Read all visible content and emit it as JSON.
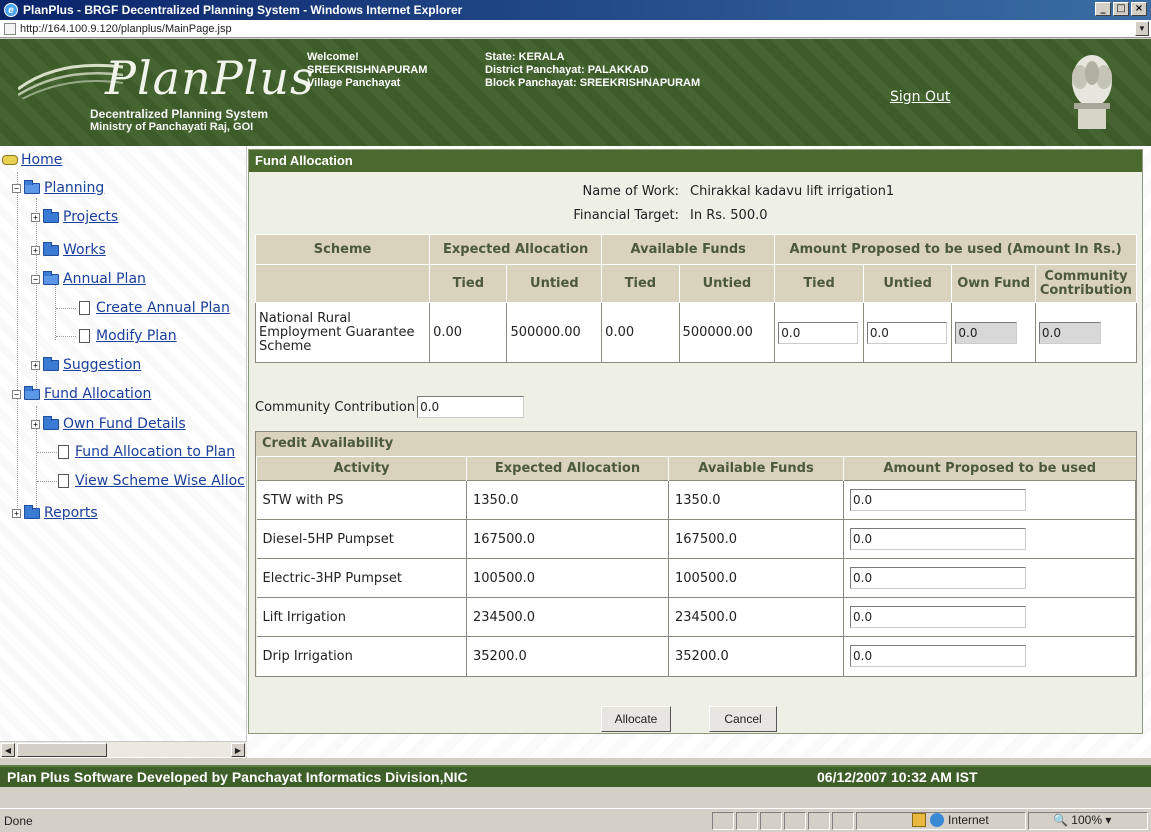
{
  "window": {
    "title": "PlanPlus - BRGF Decentralized Planning System - Windows Internet Explorer",
    "url": "http://164.100.9.120/planplus/MainPage.jsp",
    "min": "_",
    "max": "□",
    "close": "×"
  },
  "header": {
    "logo": "PlanPlus",
    "logo_sub1": "Decentralized Planning System",
    "logo_sub2": "Ministry of Panchayati Raj, GOI",
    "welcome": [
      "Welcome!",
      "SREEKRISHNAPURAM",
      "Village Panchayat"
    ],
    "state": [
      "State: KERALA",
      "District Panchayat: PALAKKAD",
      "Block Panchayat: SREEKRISHNAPURAM"
    ],
    "signout": "Sign Out"
  },
  "sidebar": {
    "home": "Home",
    "planning": "Planning",
    "projects": "Projects",
    "works": "Works",
    "annual_plan": "Annual Plan",
    "create_annual_plan": "Create Annual Plan",
    "modify_plan": "Modify Plan",
    "suggestion": "Suggestion",
    "fund_allocation": "Fund Allocation",
    "own_fund_details": "Own Fund Details",
    "fund_allocation_to_plan": "Fund Allocation to Plan",
    "view_scheme_wise": "View Scheme Wise Alloc",
    "reports": "Reports"
  },
  "main": {
    "title": "Fund Allocation",
    "name_of_work_label": "Name of Work:",
    "name_of_work": "Chirakkal kadavu lift irrigation1",
    "financial_target_label": "Financial Target:",
    "financial_target": "In Rs. 500.0",
    "fund_table": {
      "headers": {
        "scheme": "Scheme",
        "expected": "Expected Allocation",
        "available": "Available Funds",
        "proposed": "Amount Proposed to be used (Amount In Rs.)",
        "tied": "Tied",
        "untied": "Untied",
        "own_fund": "Own Fund",
        "community": "Community Contribution"
      },
      "row": {
        "scheme": "National Rural Employment Guarantee Scheme",
        "exp_tied": "0.00",
        "exp_untied": "500000.00",
        "avail_tied": "0.00",
        "avail_untied": "500000.00",
        "prop_tied": "0.0",
        "prop_untied": "0.0",
        "own_fund": "0.0",
        "community": "0.0"
      }
    },
    "community_contribution_label": "Community Contribution",
    "community_contribution_value": "0.0",
    "credit": {
      "title": "Credit Availability",
      "headers": {
        "activity": "Activity",
        "expected": "Expected Allocation",
        "available": "Available Funds",
        "proposed": "Amount Proposed to be used"
      },
      "rows": [
        {
          "activity": "STW with PS",
          "expected": "1350.0",
          "available": "1350.0",
          "proposed": "0.0"
        },
        {
          "activity": "Diesel-5HP Pumpset",
          "expected": "167500.0",
          "available": "167500.0",
          "proposed": "0.0"
        },
        {
          "activity": "Electric-3HP Pumpset",
          "expected": "100500.0",
          "available": "100500.0",
          "proposed": "0.0"
        },
        {
          "activity": "Lift Irrigation",
          "expected": "234500.0",
          "available": "234500.0",
          "proposed": "0.0"
        },
        {
          "activity": "Drip Irrigation",
          "expected": "35200.0",
          "available": "35200.0",
          "proposed": "0.0"
        }
      ]
    },
    "allocate": "Allocate",
    "cancel": "Cancel"
  },
  "footer": {
    "left": "Plan Plus Software Developed by Panchayat Informatics Division,NIC",
    "right": "06/12/2007 10:32 AM IST"
  },
  "statusbar": {
    "status": "Done",
    "zone": "Internet",
    "zoom": "100%"
  }
}
